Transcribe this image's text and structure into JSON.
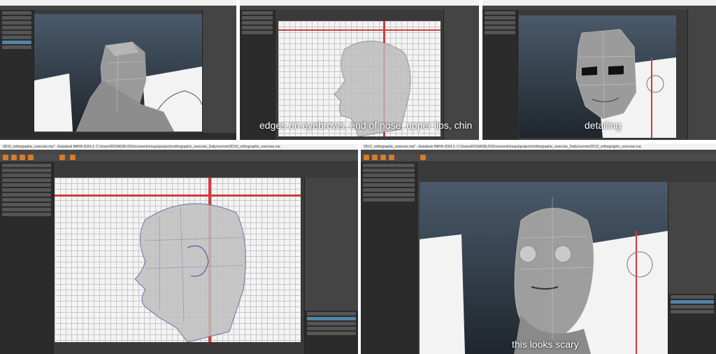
{
  "panels": [
    {
      "id": "panel-1",
      "title": "",
      "caption": ""
    },
    {
      "id": "panel-2",
      "title": "",
      "caption": "edges on eyebrows, end of nose, upper lips, chin"
    },
    {
      "id": "panel-3",
      "title": "",
      "caption": "detailing"
    },
    {
      "id": "panel-4",
      "title": "3D10_orthographic_exercise.ma* - Autodesk MAYA 2024.2: C:\\Users\\ROSADEUS\\Documents\\maya\\projects\\orthographic_exercise_Daily\\scenes\\3D10_orthographic_exercise.ma",
      "caption": ""
    },
    {
      "id": "panel-5",
      "title": "3D12_orthographic_exercise.ma* - Autodesk MAYA 2024.2: C:\\Users\\ROSADEUS\\Documents\\maya\\projects\\orthographic_exercise_Daily\\scenes\\3D12_orthographic_exercise.ma",
      "caption": "this looks scary"
    }
  ],
  "colors": {
    "accent": "#d67b2a",
    "selection": "#5285a6",
    "guide_line": "#d23a3a"
  },
  "icons": [
    "maya-shelf-icon",
    "head-mesh",
    "eye-sphere",
    "reference-sketch"
  ]
}
